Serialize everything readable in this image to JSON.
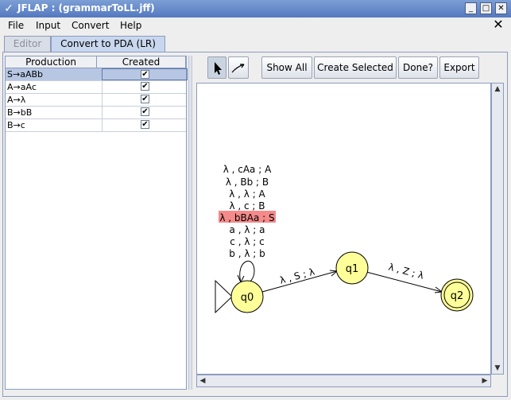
{
  "window": {
    "title": "JFLAP : (grammarToLL.jff)"
  },
  "menu": {
    "items": [
      "File",
      "Input",
      "Convert",
      "Help"
    ]
  },
  "tabs": {
    "editor": "Editor",
    "convert": "Convert to PDA (LR)"
  },
  "table": {
    "headers": [
      "Production",
      "Created"
    ],
    "rows": [
      {
        "production": "S→aABb",
        "created": true,
        "selected": true
      },
      {
        "production": "A→aAc",
        "created": true,
        "selected": false
      },
      {
        "production": "A→λ",
        "created": true,
        "selected": false
      },
      {
        "production": "B→bB",
        "created": true,
        "selected": false
      },
      {
        "production": "B→c",
        "created": true,
        "selected": false
      }
    ]
  },
  "toolbar": {
    "show_all": "Show All",
    "create_selected": "Create Selected",
    "done": "Done?",
    "export": "Export"
  },
  "automaton": {
    "states": [
      "q0",
      "q1",
      "q2"
    ],
    "initial": "q0",
    "final": "q2",
    "loop_labels": [
      "λ , cAa ; A",
      "λ , Bb ; B",
      "λ , λ ; A",
      "λ , c ; B",
      "λ , bBAa ; S",
      "a , λ ; a",
      "c , λ ; c",
      "b , λ ; b"
    ],
    "highlighted_label": "λ , bBAa ; S",
    "highlight_color": "#f48a8a",
    "state_color": "#ffff99",
    "t_q0_q1": "λ , S ; λ",
    "t_q1_q2": "λ , Z ; λ"
  }
}
